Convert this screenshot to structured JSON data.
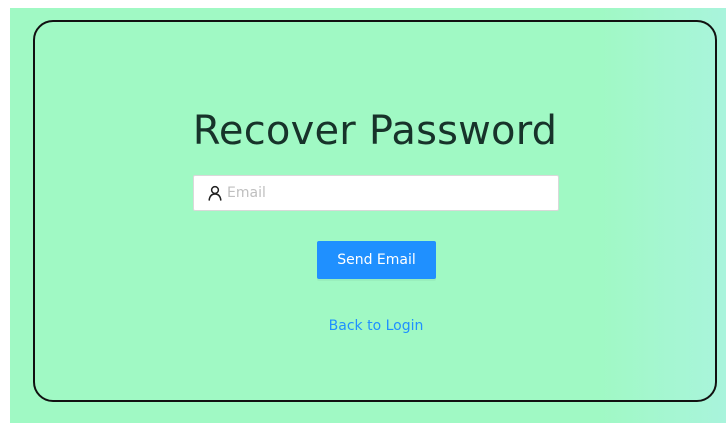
{
  "form": {
    "title": "Recover Password",
    "email_placeholder": "Email",
    "email_value": "",
    "email_icon": "user-icon",
    "submit_label": "Send Email",
    "back_link_label": "Back to Login"
  },
  "colors": {
    "background": "#a0f9c4",
    "title": "#17332a",
    "primary": "#1f90ff",
    "card_border": "#111111"
  }
}
